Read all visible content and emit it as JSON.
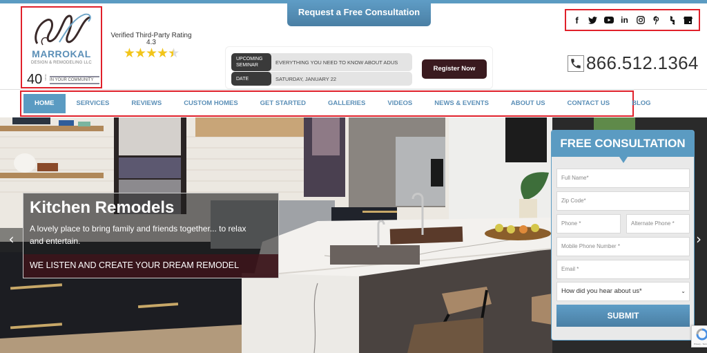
{
  "header": {
    "cta_top": "Request a Free Consultation",
    "logo": {
      "brand": "MARROKAL",
      "tagline": "DESIGN & REMODELING LLC",
      "years_number": "40",
      "years_word": "YEARS",
      "community": "IN YOUR COMMUNITY"
    },
    "rating": {
      "label": "Verified Third-Party Rating",
      "value": "4.3",
      "stars_out_of_5": 4.3
    },
    "seminar": {
      "row1_label": "UPCOMING SEMINAR",
      "row1_value": "EVERYTHING YOU NEED TO KNOW ABOUT ADUS",
      "row2_label": "DATE",
      "row2_value": "SATURDAY, JANUARY 22",
      "register_label": "Register Now"
    },
    "social": [
      {
        "name": "facebook-icon",
        "glyph": "f"
      },
      {
        "name": "twitter-icon",
        "glyph": ""
      },
      {
        "name": "youtube-icon",
        "glyph": ""
      },
      {
        "name": "linkedin-icon",
        "glyph": "in"
      },
      {
        "name": "instagram-icon",
        "glyph": ""
      },
      {
        "name": "pinterest-icon",
        "glyph": "P"
      },
      {
        "name": "houzz-icon",
        "glyph": ""
      },
      {
        "name": "google-business-icon",
        "glyph": ""
      }
    ],
    "phone": "866.512.1364"
  },
  "nav": {
    "items": [
      {
        "label": "HOME",
        "active": true
      },
      {
        "label": "SERVICES"
      },
      {
        "label": "REVIEWS"
      },
      {
        "label": "CUSTOM HOMES"
      },
      {
        "label": "GET STARTED"
      },
      {
        "label": "GALLERIES"
      },
      {
        "label": "VIDEOS"
      },
      {
        "label": "NEWS & EVENTS"
      },
      {
        "label": "ABOUT US"
      },
      {
        "label": "CONTACT US"
      },
      {
        "label": "BLOG"
      }
    ]
  },
  "hero": {
    "title": "Kitchen Remodels",
    "description": "A lovely place to bring family and friends together... to relax and entertain.",
    "band": "WE LISTEN AND CREATE YOUR DREAM REMODEL",
    "prev_glyph": "‹",
    "next_glyph": "›"
  },
  "form": {
    "title": "FREE CONSULTATION",
    "fields": {
      "full_name": "Full Name*",
      "zip": "Zip Code*",
      "phone": "Phone *",
      "alt_phone": "Alternate Phone *",
      "mobile": "Mobile Phone Number *",
      "email": "Email *",
      "source_select": "How did you hear about us*"
    },
    "submit_label": "SUBMIT",
    "recaptcha_label": "Privacy - Terms"
  },
  "colors": {
    "accent_blue": "#5b9bc2",
    "register_maroon": "#3a1a1f",
    "highlight_red": "#e0202a",
    "star_gold": "#f2c51a"
  }
}
